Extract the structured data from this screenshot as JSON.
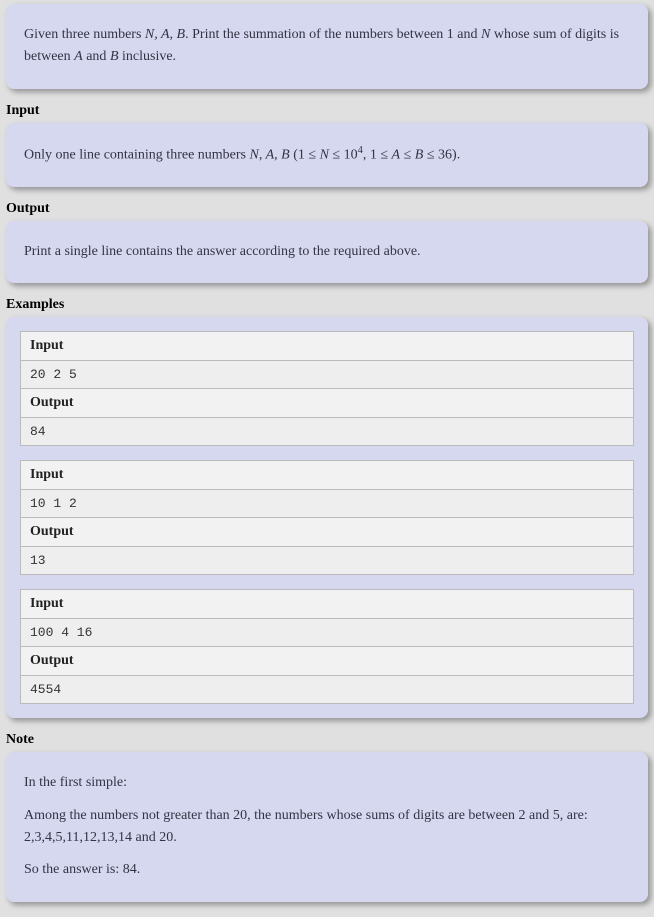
{
  "problem": {
    "statement_parts": {
      "p1_a": "Given three numbers ",
      "p1_vars": "N, A, B",
      "p1_b": ". Print the summation of the numbers between 1 and ",
      "p1_n": "N",
      "p1_c": " whose sum of digits is between ",
      "p1_a2": "A",
      "p1_d": " and ",
      "p1_b2": "B",
      "p1_e": " inclusive."
    }
  },
  "input": {
    "title": "Input",
    "parts": {
      "a": "Only one line containing three numbers ",
      "vars": "N, A, B",
      "b": " (1 ≤ ",
      "n": "N",
      "c": " ≤ 10",
      "exp": "4",
      "d": ", 1 ≤ ",
      "av": "A",
      "e": " ≤ ",
      "bv": "B",
      "f": " ≤ 36)."
    }
  },
  "output": {
    "title": "Output",
    "text": "Print a single line contains the answer according to the required above."
  },
  "examples": {
    "title": "Examples",
    "label_input": "Input",
    "label_output": "Output",
    "cases": [
      {
        "in": "20 2 5",
        "out": "84"
      },
      {
        "in": "10 1 2",
        "out": "13"
      },
      {
        "in": "100 4 16",
        "out": "4554"
      }
    ]
  },
  "note": {
    "title": "Note",
    "p1": "In the first simple:",
    "p2": "Among the numbers not greater than 20, the numbers whose sums of digits are between 2 and 5, are: 2,3,4,5,11,12,13,14 and 20.",
    "p3": "So the answer is: 84."
  }
}
